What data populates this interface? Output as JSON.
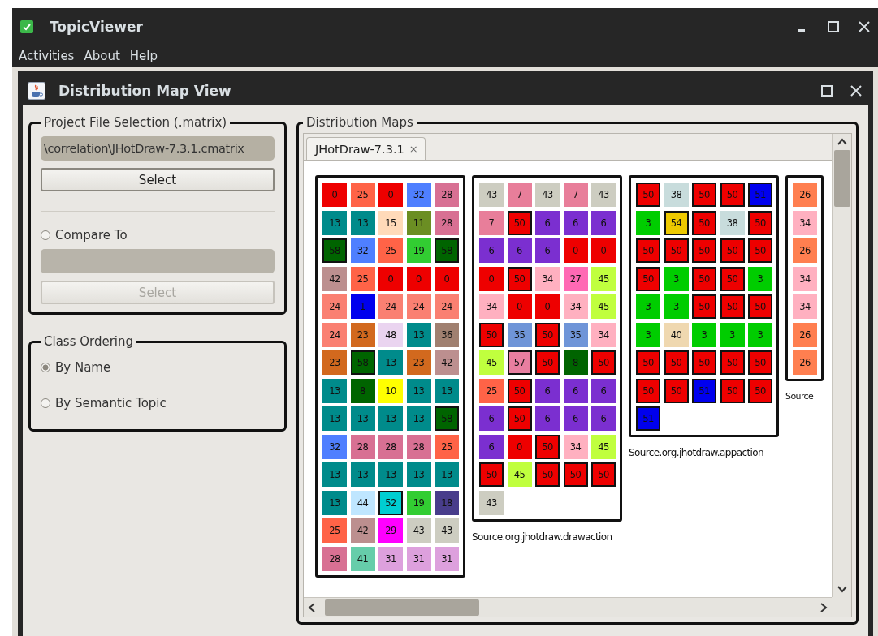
{
  "window": {
    "title": "TopicViewer"
  },
  "menu": [
    "Activities",
    "About",
    "Help"
  ],
  "view": {
    "title": "Distribution Map View"
  },
  "file_selection": {
    "legend": "Project File Selection (.matrix)",
    "path": "\\correlation\\JHotDraw-7.3.1.cmatrix",
    "button": "Select",
    "compare": {
      "label": "Compare To",
      "selected": false
    },
    "compare_field": {
      "disabled": true
    },
    "compare_button": {
      "label": "Select",
      "disabled": true
    }
  },
  "class_ordering": {
    "legend": "Class Ordering",
    "options": [
      {
        "label": "By Name",
        "selected": true
      },
      {
        "label": "By Semantic Topic",
        "selected": false
      }
    ]
  },
  "maps_panel": {
    "legend": "Distribution Maps",
    "tabs": [
      {
        "label": "JHotDraw-7.3.1",
        "close": "×",
        "selected": true
      }
    ],
    "maps": [
      {
        "rows": [
          [
            {
              "value": "0",
              "color": "#ee0000",
              "marked": false
            },
            {
              "value": "25",
              "color": "#ff6347",
              "marked": false
            },
            {
              "value": "0",
              "color": "#ee0000",
              "marked": false
            },
            {
              "value": "32",
              "color": "#4f7fff",
              "marked": false
            },
            {
              "value": "28",
              "color": "#d87093",
              "marked": false
            }
          ],
          [
            {
              "value": "13",
              "color": "#008b8b",
              "marked": false
            },
            {
              "value": "13",
              "color": "#008b8b",
              "marked": false
            },
            {
              "value": "15",
              "color": "#ffdab9",
              "marked": false
            },
            {
              "value": "11",
              "color": "#6b8e23",
              "marked": false
            },
            {
              "value": "28",
              "color": "#d87093",
              "marked": false
            }
          ],
          [
            {
              "value": "58",
              "color": "#006400",
              "marked": true
            },
            {
              "value": "32",
              "color": "#4f7fff",
              "marked": false
            },
            {
              "value": "25",
              "color": "#ff6347",
              "marked": false
            },
            {
              "value": "19",
              "color": "#32cd32",
              "marked": false
            },
            {
              "value": "58",
              "color": "#006400",
              "marked": true
            }
          ],
          [
            {
              "value": "42",
              "color": "#bc8f8f",
              "marked": false
            },
            {
              "value": "25",
              "color": "#ff6347",
              "marked": false
            },
            {
              "value": "0",
              "color": "#ee0000",
              "marked": false
            },
            {
              "value": "0",
              "color": "#ee0000",
              "marked": false
            },
            {
              "value": "0",
              "color": "#ee0000",
              "marked": false
            }
          ],
          [
            {
              "value": "24",
              "color": "#fa8072",
              "marked": false
            },
            {
              "value": "1",
              "color": "#0000ee",
              "marked": false
            },
            {
              "value": "24",
              "color": "#fa8072",
              "marked": false
            },
            {
              "value": "24",
              "color": "#fa8072",
              "marked": false
            },
            {
              "value": "24",
              "color": "#fa8072",
              "marked": false
            }
          ],
          [
            {
              "value": "24",
              "color": "#fa8072",
              "marked": false
            },
            {
              "value": "23",
              "color": "#d2691e",
              "marked": false
            },
            {
              "value": "48",
              "color": "#ead4f0",
              "marked": false
            },
            {
              "value": "13",
              "color": "#008b8b",
              "marked": false
            },
            {
              "value": "36",
              "color": "#a08070",
              "marked": false
            }
          ],
          [
            {
              "value": "23",
              "color": "#d2691e",
              "marked": false
            },
            {
              "value": "58",
              "color": "#006400",
              "marked": true
            },
            {
              "value": "13",
              "color": "#008b8b",
              "marked": false
            },
            {
              "value": "23",
              "color": "#d2691e",
              "marked": false
            },
            {
              "value": "42",
              "color": "#bc8f8f",
              "marked": false
            }
          ],
          [
            {
              "value": "13",
              "color": "#008b8b",
              "marked": false
            },
            {
              "value": "8",
              "color": "#006400",
              "marked": false
            },
            {
              "value": "10",
              "color": "#ffff00",
              "marked": false
            },
            {
              "value": "13",
              "color": "#008b8b",
              "marked": false
            },
            {
              "value": "13",
              "color": "#008b8b",
              "marked": false
            }
          ],
          [
            {
              "value": "13",
              "color": "#008b8b",
              "marked": false
            },
            {
              "value": "13",
              "color": "#008b8b",
              "marked": false
            },
            {
              "value": "13",
              "color": "#008b8b",
              "marked": false
            },
            {
              "value": "13",
              "color": "#008b8b",
              "marked": false
            },
            {
              "value": "58",
              "color": "#006400",
              "marked": true
            }
          ],
          [
            {
              "value": "32",
              "color": "#4f7fff",
              "marked": false
            },
            {
              "value": "28",
              "color": "#d87093",
              "marked": false
            },
            {
              "value": "28",
              "color": "#d87093",
              "marked": false
            },
            {
              "value": "28",
              "color": "#d87093",
              "marked": false
            },
            {
              "value": "25",
              "color": "#ff6347",
              "marked": false
            }
          ],
          [
            {
              "value": "13",
              "color": "#008b8b",
              "marked": false
            },
            {
              "value": "13",
              "color": "#008b8b",
              "marked": false
            },
            {
              "value": "13",
              "color": "#008b8b",
              "marked": false
            },
            {
              "value": "13",
              "color": "#008b8b",
              "marked": false
            },
            {
              "value": "13",
              "color": "#008b8b",
              "marked": false
            }
          ],
          [
            {
              "value": "13",
              "color": "#008b8b",
              "marked": false
            },
            {
              "value": "44",
              "color": "#bfe6ff",
              "marked": false
            },
            {
              "value": "52",
              "color": "#00ced1",
              "marked": true
            },
            {
              "value": "19",
              "color": "#32cd32",
              "marked": false
            },
            {
              "value": "18",
              "color": "#483d8b",
              "marked": false
            }
          ],
          [
            {
              "value": "25",
              "color": "#ff6347",
              "marked": false
            },
            {
              "value": "42",
              "color": "#bc8f8f",
              "marked": false
            },
            {
              "value": "29",
              "color": "#ff00ff",
              "marked": false
            },
            {
              "value": "43",
              "color": "#cdcdc1",
              "marked": false
            },
            {
              "value": "43",
              "color": "#cdcdc1",
              "marked": false
            }
          ],
          [
            {
              "value": "28",
              "color": "#d87093",
              "marked": false
            },
            {
              "value": "41",
              "color": "#66cdaa",
              "marked": false
            },
            {
              "value": "31",
              "color": "#dda0dd",
              "marked": false
            },
            {
              "value": "31",
              "color": "#dda0dd",
              "marked": false
            },
            {
              "value": "31",
              "color": "#dda0dd",
              "marked": false
            }
          ]
        ]
      },
      {
        "label": "Source.org.jhotdraw.drawaction",
        "rows": [
          [
            {
              "value": "43",
              "color": "#cdcdc1",
              "marked": false
            },
            {
              "value": "7",
              "color": "#e87e9a",
              "marked": false
            },
            {
              "value": "43",
              "color": "#cdcdc1",
              "marked": false
            },
            {
              "value": "7",
              "color": "#e87e9a",
              "marked": false
            },
            {
              "value": "43",
              "color": "#cdcdc1",
              "marked": false
            }
          ],
          [
            {
              "value": "7",
              "color": "#e87e9a",
              "marked": false
            },
            {
              "value": "50",
              "color": "#ee0000",
              "marked": true
            },
            {
              "value": "6",
              "color": "#7b2fd0",
              "marked": false
            },
            {
              "value": "6",
              "color": "#7b2fd0",
              "marked": false
            },
            {
              "value": "6",
              "color": "#7b2fd0",
              "marked": false
            }
          ],
          [
            {
              "value": "6",
              "color": "#7b2fd0",
              "marked": false
            },
            {
              "value": "6",
              "color": "#7b2fd0",
              "marked": false
            },
            {
              "value": "6",
              "color": "#7b2fd0",
              "marked": false
            },
            {
              "value": "0",
              "color": "#ee0000",
              "marked": false
            },
            {
              "value": "0",
              "color": "#ee0000",
              "marked": false
            }
          ],
          [
            {
              "value": "0",
              "color": "#ee0000",
              "marked": false
            },
            {
              "value": "50",
              "color": "#ee0000",
              "marked": true
            },
            {
              "value": "34",
              "color": "#ffb0c0",
              "marked": false
            },
            {
              "value": "27",
              "color": "#ff69b4",
              "marked": false
            },
            {
              "value": "45",
              "color": "#c0ff3e",
              "marked": false
            }
          ],
          [
            {
              "value": "34",
              "color": "#ffb0c0",
              "marked": false
            },
            {
              "value": "0",
              "color": "#ee0000",
              "marked": false
            },
            {
              "value": "0",
              "color": "#ee0000",
              "marked": false
            },
            {
              "value": "34",
              "color": "#ffb0c0",
              "marked": false
            },
            {
              "value": "45",
              "color": "#c0ff3e",
              "marked": false
            }
          ],
          [
            {
              "value": "50",
              "color": "#ee0000",
              "marked": true
            },
            {
              "value": "35",
              "color": "#6f95d8",
              "marked": false
            },
            {
              "value": "50",
              "color": "#ee0000",
              "marked": true
            },
            {
              "value": "35",
              "color": "#6f95d8",
              "marked": false
            },
            {
              "value": "34",
              "color": "#ffb0c0",
              "marked": false
            }
          ],
          [
            {
              "value": "45",
              "color": "#c0ff3e",
              "marked": false
            },
            {
              "value": "57",
              "color": "#e87ea0",
              "marked": true
            },
            {
              "value": "50",
              "color": "#ee0000",
              "marked": true
            },
            {
              "value": "8",
              "color": "#006400",
              "marked": false
            },
            {
              "value": "50",
              "color": "#ee0000",
              "marked": true
            }
          ],
          [
            {
              "value": "25",
              "color": "#ff6347",
              "marked": false
            },
            {
              "value": "50",
              "color": "#ee0000",
              "marked": true
            },
            {
              "value": "6",
              "color": "#7b2fd0",
              "marked": false
            },
            {
              "value": "6",
              "color": "#7b2fd0",
              "marked": false
            },
            {
              "value": "6",
              "color": "#7b2fd0",
              "marked": false
            }
          ],
          [
            {
              "value": "6",
              "color": "#7b2fd0",
              "marked": false
            },
            {
              "value": "50",
              "color": "#ee0000",
              "marked": true
            },
            {
              "value": "6",
              "color": "#7b2fd0",
              "marked": false
            },
            {
              "value": "6",
              "color": "#7b2fd0",
              "marked": false
            },
            {
              "value": "6",
              "color": "#7b2fd0",
              "marked": false
            }
          ],
          [
            {
              "value": "6",
              "color": "#7b2fd0",
              "marked": false
            },
            {
              "value": "0",
              "color": "#ee0000",
              "marked": false
            },
            {
              "value": "50",
              "color": "#ee0000",
              "marked": true
            },
            {
              "value": "34",
              "color": "#ffb0c0",
              "marked": false
            },
            {
              "value": "45",
              "color": "#c0ff3e",
              "marked": false
            }
          ],
          [
            {
              "value": "50",
              "color": "#ee0000",
              "marked": true
            },
            {
              "value": "45",
              "color": "#c0ff3e",
              "marked": false
            },
            {
              "value": "50",
              "color": "#ee0000",
              "marked": true
            },
            {
              "value": "50",
              "color": "#ee0000",
              "marked": true
            },
            {
              "value": "50",
              "color": "#ee0000",
              "marked": true
            }
          ],
          [
            {
              "value": "43",
              "color": "#cdcdc1",
              "marked": false
            }
          ]
        ]
      },
      {
        "label": "Source.org.jhotdraw.appaction",
        "rows": [
          [
            {
              "value": "50",
              "color": "#ee0000",
              "marked": true
            },
            {
              "value": "38",
              "color": "#c8dcdc",
              "marked": false
            },
            {
              "value": "50",
              "color": "#ee0000",
              "marked": true
            },
            {
              "value": "50",
              "color": "#ee0000",
              "marked": true
            },
            {
              "value": "51",
              "color": "#0000ee",
              "marked": true
            }
          ],
          [
            {
              "value": "3",
              "color": "#00cd00",
              "marked": false
            },
            {
              "value": "54",
              "color": "#eec900",
              "marked": true
            },
            {
              "value": "50",
              "color": "#ee0000",
              "marked": true
            },
            {
              "value": "38",
              "color": "#c8dcdc",
              "marked": false
            },
            {
              "value": "50",
              "color": "#ee0000",
              "marked": true
            }
          ],
          [
            {
              "value": "50",
              "color": "#ee0000",
              "marked": true
            },
            {
              "value": "50",
              "color": "#ee0000",
              "marked": true
            },
            {
              "value": "50",
              "color": "#ee0000",
              "marked": true
            },
            {
              "value": "50",
              "color": "#ee0000",
              "marked": true
            },
            {
              "value": "50",
              "color": "#ee0000",
              "marked": true
            }
          ],
          [
            {
              "value": "50",
              "color": "#ee0000",
              "marked": true
            },
            {
              "value": "3",
              "color": "#00cd00",
              "marked": false
            },
            {
              "value": "50",
              "color": "#ee0000",
              "marked": true
            },
            {
              "value": "50",
              "color": "#ee0000",
              "marked": true
            },
            {
              "value": "3",
              "color": "#00cd00",
              "marked": false
            }
          ],
          [
            {
              "value": "3",
              "color": "#00cd00",
              "marked": false
            },
            {
              "value": "3",
              "color": "#00cd00",
              "marked": false
            },
            {
              "value": "50",
              "color": "#ee0000",
              "marked": true
            },
            {
              "value": "50",
              "color": "#ee0000",
              "marked": true
            },
            {
              "value": "50",
              "color": "#ee0000",
              "marked": true
            }
          ],
          [
            {
              "value": "3",
              "color": "#00cd00",
              "marked": false
            },
            {
              "value": "40",
              "color": "#efd8b0",
              "marked": false
            },
            {
              "value": "3",
              "color": "#00cd00",
              "marked": false
            },
            {
              "value": "3",
              "color": "#00cd00",
              "marked": false
            },
            {
              "value": "3",
              "color": "#00cd00",
              "marked": false
            }
          ],
          [
            {
              "value": "50",
              "color": "#ee0000",
              "marked": true
            },
            {
              "value": "50",
              "color": "#ee0000",
              "marked": true
            },
            {
              "value": "50",
              "color": "#ee0000",
              "marked": true
            },
            {
              "value": "50",
              "color": "#ee0000",
              "marked": true
            },
            {
              "value": "50",
              "color": "#ee0000",
              "marked": true
            }
          ],
          [
            {
              "value": "50",
              "color": "#ee0000",
              "marked": true
            },
            {
              "value": "50",
              "color": "#ee0000",
              "marked": true
            },
            {
              "value": "51",
              "color": "#0000ee",
              "marked": true
            },
            {
              "value": "50",
              "color": "#ee0000",
              "marked": true
            },
            {
              "value": "50",
              "color": "#ee0000",
              "marked": true
            }
          ],
          [
            {
              "value": "51",
              "color": "#0000ee",
              "marked": true
            }
          ]
        ]
      },
      {
        "label": "Source",
        "rows": [
          [
            {
              "value": "26",
              "color": "#ff7f50",
              "marked": false
            }
          ],
          [
            {
              "value": "34",
              "color": "#ffb0c0",
              "marked": false
            }
          ],
          [
            {
              "value": "26",
              "color": "#ff7f50",
              "marked": false
            }
          ],
          [
            {
              "value": "34",
              "color": "#ffb0c0",
              "marked": false
            }
          ],
          [
            {
              "value": "34",
              "color": "#ffb0c0",
              "marked": false
            }
          ],
          [
            {
              "value": "26",
              "color": "#ff7f50",
              "marked": false
            }
          ],
          [
            {
              "value": "26",
              "color": "#ff7f50",
              "marked": false
            }
          ]
        ]
      }
    ]
  }
}
